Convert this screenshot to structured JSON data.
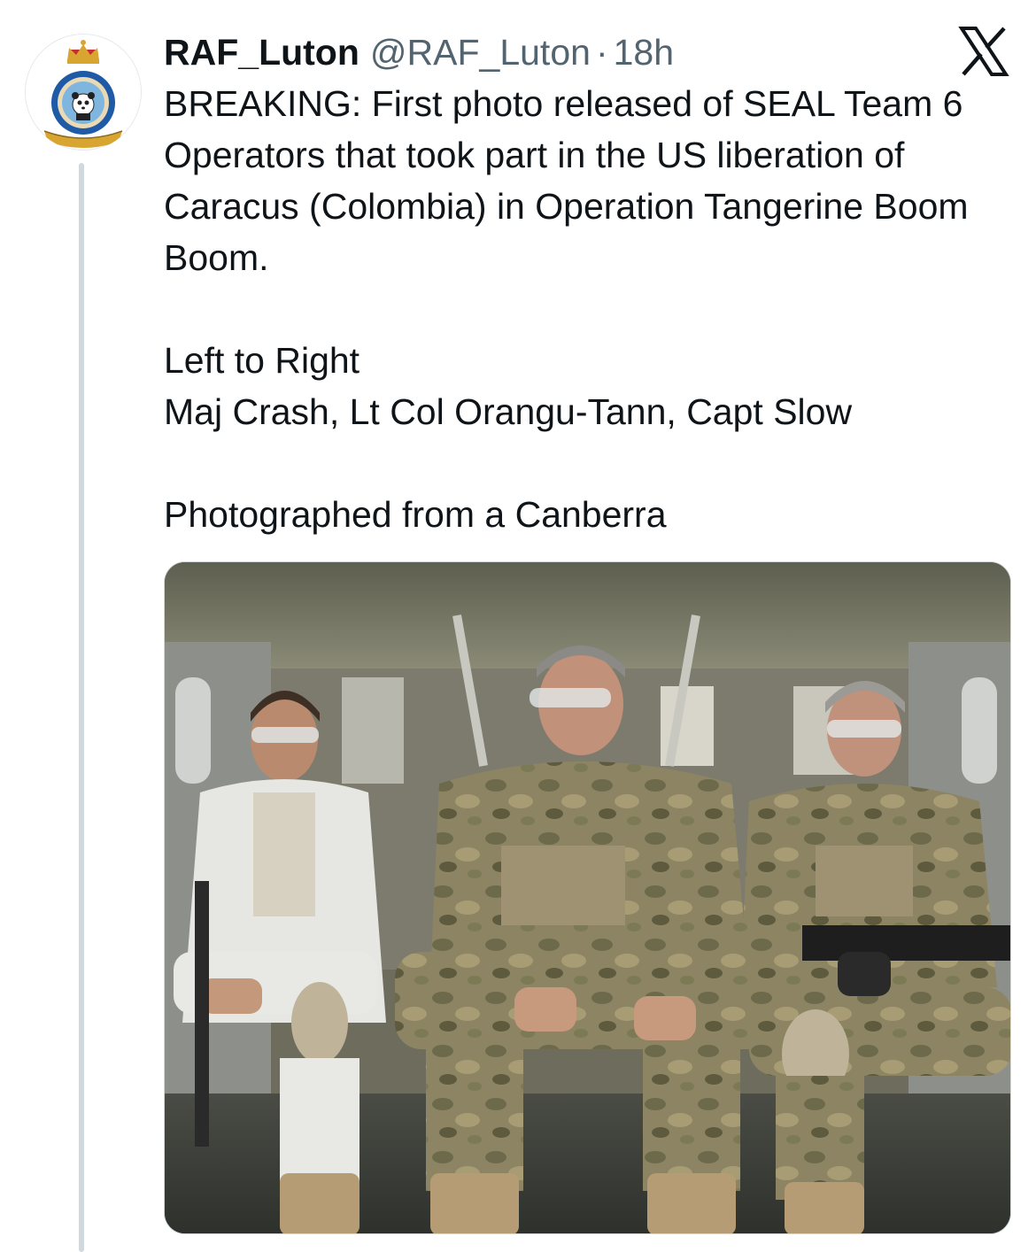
{
  "tweet": {
    "display_name": "RAF_Luton",
    "handle": "@RAF_Luton",
    "separator": "·",
    "time": "18h",
    "avatar_icon": "raf-station-crest-icon",
    "platform_icon": "x-logo-icon",
    "text": {
      "paragraph1": "BREAKING: First photo released of SEAL Team 6 Operators that took part in the US liberation of Caracus (Colombia) in Operation Tangerine Boom Boom.",
      "line_left_to_right": "Left to Right",
      "line_names": "Maj Crash, Lt Col Orangu-Tann, Capt Slow",
      "line_photographed": "Photographed from a Canberra"
    },
    "media": {
      "kind": "photo",
      "subject": "three men in camouflage gear seated in a helicopter cabin"
    }
  },
  "colors": {
    "text_primary": "#0f1419",
    "text_secondary": "#536471",
    "thread_line": "#cfd9de"
  }
}
